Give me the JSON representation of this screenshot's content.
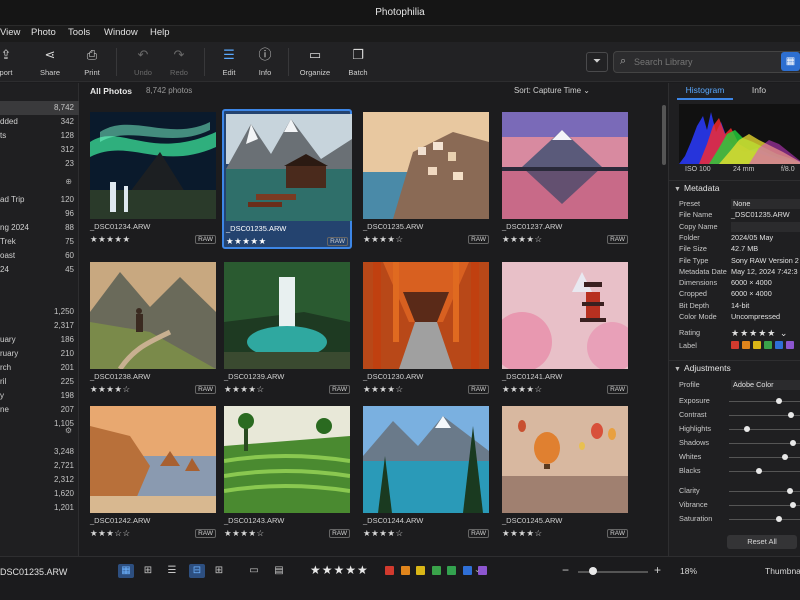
{
  "app": {
    "title": "Photophilia"
  },
  "menu": [
    "View",
    "Photo",
    "Tools",
    "Window",
    "Help"
  ],
  "toolbar": {
    "buttons": [
      {
        "label": "port",
        "icon": "export-icon"
      },
      {
        "label": "Share",
        "icon": "share-icon"
      },
      {
        "label": "Print",
        "icon": "printer-icon"
      },
      {
        "label": "Undo",
        "icon": "undo-icon"
      },
      {
        "label": "Redo",
        "icon": "redo-icon"
      },
      {
        "label": "Edit",
        "icon": "sliders-icon"
      },
      {
        "label": "Info",
        "icon": "info-icon"
      },
      {
        "label": "Organize",
        "icon": "folder-icon"
      },
      {
        "label": "Batch",
        "icon": "batch-icon"
      }
    ],
    "search_placeholder": "Search Library"
  },
  "sidebar": {
    "rows": [
      {
        "name": "",
        "count": "8,742",
        "selected": true
      },
      {
        "name": "dded",
        "count": "342"
      },
      {
        "name": "ts",
        "count": "128"
      },
      {
        "name": "",
        "count": "312"
      },
      {
        "name": "",
        "count": "23"
      },
      {
        "name": "ad Trip",
        "count": "120"
      },
      {
        "name": "",
        "count": "96"
      },
      {
        "name": "ng 2024",
        "count": "88"
      },
      {
        "name": "Trek",
        "count": "75"
      },
      {
        "name": "oast",
        "count": "60"
      },
      {
        "name": "24",
        "count": "45"
      },
      {
        "name": "",
        "count": "1,250"
      },
      {
        "name": "",
        "count": "2,317"
      },
      {
        "name": "uary",
        "count": "186"
      },
      {
        "name": "ruary",
        "count": "210"
      },
      {
        "name": "rch",
        "count": "201"
      },
      {
        "name": "ril",
        "count": "225"
      },
      {
        "name": "y",
        "count": "198"
      },
      {
        "name": "ne",
        "count": "207"
      },
      {
        "name": "",
        "count": "1,105"
      },
      {
        "name": "",
        "count": "3,248"
      },
      {
        "name": "",
        "count": "2,721"
      },
      {
        "name": "",
        "count": "2,312"
      },
      {
        "name": "",
        "count": "1,620"
      },
      {
        "name": "",
        "count": "1,201"
      }
    ]
  },
  "library": {
    "title": "All Photos",
    "count": "8,742 photos",
    "sort": "Sort: Capture Time ⌄"
  },
  "photos": [
    {
      "file": "_DSC01234.ARW",
      "rating": 5,
      "badge": "RAW",
      "scene": "aurora"
    },
    {
      "file": "_DSC01235.ARW",
      "rating": 5,
      "badge": "RAW",
      "scene": "lake-cabin",
      "selected": true
    },
    {
      "file": "_DSC01235.ARW",
      "rating": 4,
      "badge": "RAW",
      "scene": "coastal-town"
    },
    {
      "file": "_DSC01237.ARW",
      "rating": 4,
      "badge": "RAW",
      "scene": "mountain-reflection"
    },
    {
      "file": "_DSC01238.ARW",
      "rating": 4,
      "badge": "RAW",
      "scene": "hiker-valley"
    },
    {
      "file": "_DSC01239.ARW",
      "rating": 4,
      "badge": "RAW",
      "scene": "waterfall"
    },
    {
      "file": "_DSC01230.ARW",
      "rating": 4,
      "badge": "RAW",
      "scene": "torii-path"
    },
    {
      "file": "_DSC01241.ARW",
      "rating": 4,
      "badge": "RAW",
      "scene": "pagoda-blossom"
    },
    {
      "file": "_DSC01242.ARW",
      "rating": 3,
      "badge": "RAW",
      "scene": "sea-cliffs"
    },
    {
      "file": "_DSC01243.ARW",
      "rating": 4,
      "badge": "RAW",
      "scene": "rice-terraces"
    },
    {
      "file": "_DSC01244.ARW",
      "rating": 4,
      "badge": "RAW",
      "scene": "alpine-lake"
    },
    {
      "file": "_DSC01245.ARW",
      "rating": 4,
      "badge": "RAW",
      "scene": "balloons"
    }
  ],
  "panel": {
    "tabs": [
      "Histogram",
      "Info",
      ""
    ],
    "histogram": {
      "iso": "ISO 100",
      "focal": "24 mm",
      "aperture": "f/8.0"
    },
    "metadata_title": "Metadata",
    "metadata": [
      {
        "k": "Preset",
        "v": "None",
        "field": true
      },
      {
        "k": "File Name",
        "v": "_DSC01235.ARW"
      },
      {
        "k": "Copy Name",
        "v": "",
        "field": true
      },
      {
        "k": "Folder",
        "v": "2024/05 May"
      },
      {
        "k": "File Size",
        "v": "42.7 MB"
      },
      {
        "k": "File Type",
        "v": "Sony RAW Version 2"
      },
      {
        "k": "Metadata Date",
        "v": "May 12, 2024 7:42:3"
      },
      {
        "k": "Dimensions",
        "v": "6000 × 4000"
      },
      {
        "k": "Cropped",
        "v": "6000 × 4000"
      },
      {
        "k": "Bit Depth",
        "v": "14-bit"
      },
      {
        "k": "Color Mode",
        "v": "Uncompressed"
      }
    ],
    "rating_label": "Rating",
    "rating_value": 5,
    "label_label": "Label",
    "label_colors": [
      "#d23a2e",
      "#e0851c",
      "#d9b617",
      "#3aa34a",
      "#2f6fd6",
      "#8d56d0"
    ],
    "adjust_title": "Adjustments",
    "profile_label": "Profile",
    "profile_value": "Adobe Color",
    "sliders": [
      {
        "k": "Exposure",
        "v": 0.62
      },
      {
        "k": "Contrast",
        "v": 0.78
      },
      {
        "k": "Highlights",
        "v": 0.22
      },
      {
        "k": "Shadows",
        "v": 0.8
      },
      {
        "k": "Whites",
        "v": 0.7
      },
      {
        "k": "Blacks",
        "v": 0.38
      },
      {
        "k": "Clarity",
        "v": 0.76
      },
      {
        "k": "Vibrance",
        "v": 0.8
      },
      {
        "k": "Saturation",
        "v": 0.62
      }
    ],
    "reset_label": "Reset All"
  },
  "bottom": {
    "current_file": "DSC01235.ARW",
    "stars": "★★★★★",
    "colors": [
      "#d23a2e",
      "#e0851c",
      "#d9b617",
      "#3aa34a",
      "#33a24f",
      "#2f6fd6",
      "#8d56d0"
    ],
    "zoom_value": "18%",
    "zoom_level": 0.22,
    "view_mode_label": "Thumbna"
  }
}
